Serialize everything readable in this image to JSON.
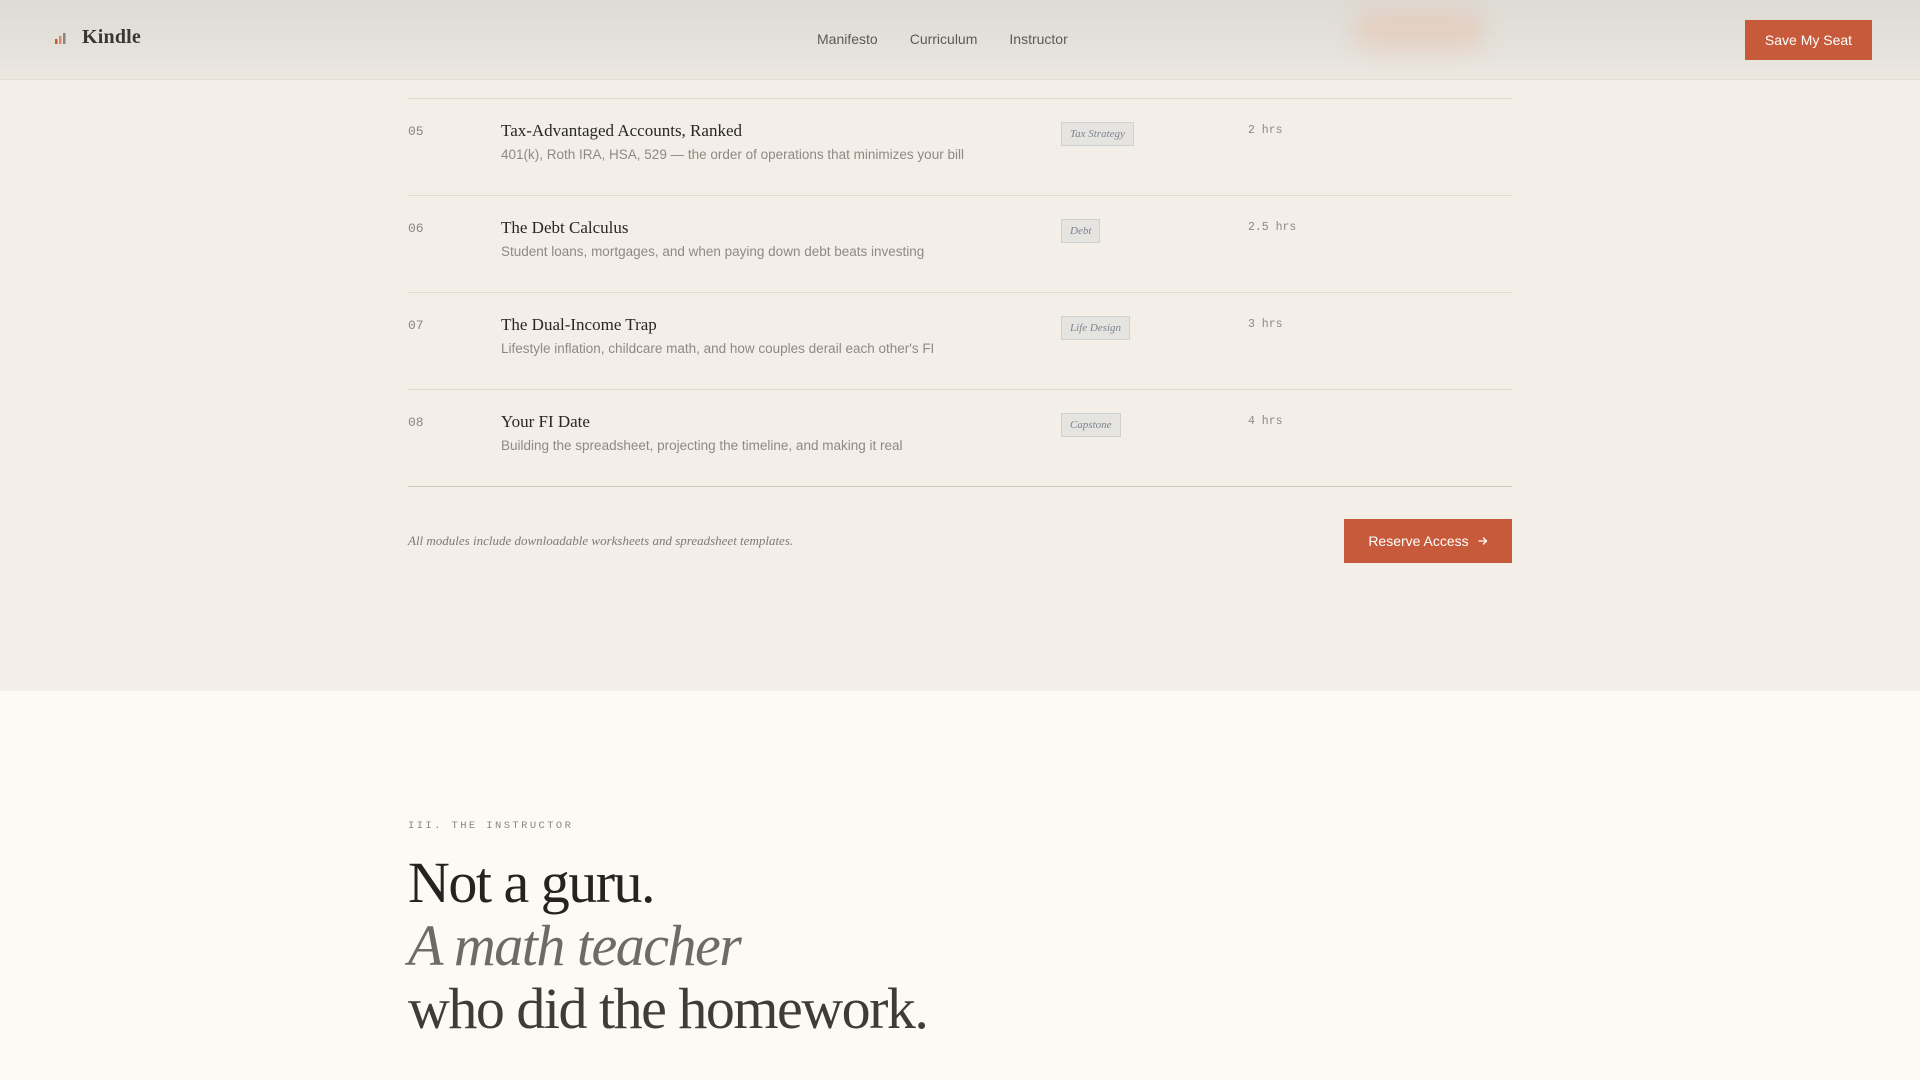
{
  "header": {
    "brand_name": "Kindle",
    "nav": [
      "Manifesto",
      "Curriculum",
      "Instructor"
    ],
    "cta_label": "Save My Seat"
  },
  "curriculum": {
    "modules": [
      {
        "number": "05",
        "title": "Tax-Advantaged Accounts, Ranked",
        "description": "401(k), Roth IRA, HSA, 529 — the order of operations that minimizes your bill",
        "tag": "Tax Strategy",
        "duration": "2 hrs"
      },
      {
        "number": "06",
        "title": "The Debt Calculus",
        "description": "Student loans, mortgages, and when paying down debt beats investing",
        "tag": "Debt",
        "duration": "2.5 hrs"
      },
      {
        "number": "07",
        "title": "The Dual-Income Trap",
        "description": "Lifestyle inflation, childcare math, and how couples derail each other's FI",
        "tag": "Life Design",
        "duration": "3 hrs"
      },
      {
        "number": "08",
        "title": "Your FI Date",
        "description": "Building the spreadsheet, projecting the timeline, and making it real",
        "tag": "Capstone",
        "duration": "4 hrs"
      }
    ],
    "footnote": "All modules include downloadable worksheets and spreadsheet templates.",
    "reserve_label": "Reserve Access"
  },
  "instructor": {
    "eyebrow": "III. THE INSTRUCTOR",
    "headline_line1": "Not a guru.",
    "headline_line2": "A math teacher",
    "headline_line3": "who did the homework."
  },
  "colors": {
    "accent": "#c65a3a",
    "page_bg": "#f3efe8",
    "section_bg": "#fcfaf5"
  }
}
